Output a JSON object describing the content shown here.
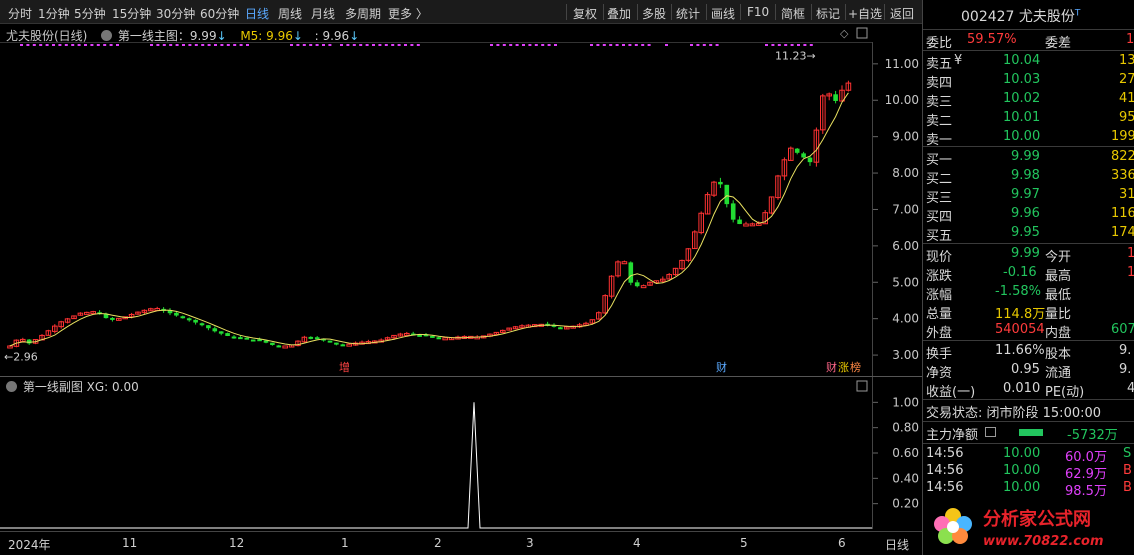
{
  "toolbar": {
    "periods": [
      "分时",
      "1分钟",
      "5分钟",
      "15分钟",
      "30分钟",
      "60分钟",
      "日线",
      "周线",
      "月线",
      "多周期",
      "更多 〉"
    ],
    "buttons": [
      "复权",
      "叠加",
      "多股",
      "统计",
      "画线",
      "F10",
      "简框",
      "标记",
      "+自选",
      "返回"
    ]
  },
  "chart": {
    "stock_label": "尤夫股份(日线)",
    "indicator_name": "第一线主图：9.99",
    "ma_label": "M5: 9.96",
    "ma2_label": ": 9.96",
    "low_marker": "←2.96",
    "high_marker": "11.23→",
    "price_ticks": [
      "11.00",
      "10.00",
      "9.00",
      "8.00",
      "7.00",
      "6.00",
      "5.00",
      "4.00",
      "3.00"
    ],
    "events": [
      "增",
      "财",
      "财",
      "涨",
      "榜"
    ],
    "sub_indicator": "第一线副图  XG: 0.00",
    "sub_ticks": [
      "1.00",
      "0.80",
      "0.60",
      "0.40",
      "0.20"
    ],
    "time_labels": [
      "2024年",
      "11",
      "12",
      "1",
      "2",
      "3",
      "4",
      "5",
      "6"
    ],
    "period_tag": "日线"
  },
  "chart_data": {
    "type": "candlestick",
    "ylim": [
      2.7,
      11.6
    ],
    "low": 2.96,
    "high": 11.23,
    "last_close": 9.99,
    "ma5": 9.96,
    "sub_indicator_ylim": [
      0,
      1.05
    ],
    "sub_indicator_spike": 1.0
  },
  "quote": {
    "code_name": "002427 尤夫股份",
    "wei_bi_label": "委比",
    "wei_bi": "59.57%",
    "wei_cha_label": "委差",
    "wei_cha": "1",
    "asks": [
      {
        "label": "卖五",
        "flag": "¥",
        "price": "10.04",
        "vol": "13"
      },
      {
        "label": "卖四",
        "flag": "",
        "price": "10.03",
        "vol": "27"
      },
      {
        "label": "卖三",
        "flag": "",
        "price": "10.02",
        "vol": "41"
      },
      {
        "label": "卖二",
        "flag": "",
        "price": "10.01",
        "vol": "95"
      },
      {
        "label": "卖一",
        "flag": "",
        "price": "10.00",
        "vol": "199"
      }
    ],
    "bids": [
      {
        "label": "买一",
        "price": "9.99",
        "vol": "822"
      },
      {
        "label": "买二",
        "price": "9.98",
        "vol": "336"
      },
      {
        "label": "买三",
        "price": "9.97",
        "vol": "31"
      },
      {
        "label": "买四",
        "price": "9.96",
        "vol": "116"
      },
      {
        "label": "买五",
        "price": "9.95",
        "vol": "174"
      }
    ],
    "stats": [
      {
        "l1": "现价",
        "v1": "9.99",
        "c1": "green",
        "l2": "今开",
        "v2": "1",
        "c2": "red"
      },
      {
        "l1": "涨跌",
        "v1": "-0.16",
        "c1": "green",
        "l2": "最高",
        "v2": "1",
        "c2": "red"
      },
      {
        "l1": "涨幅",
        "v1": "-1.58%",
        "c1": "green",
        "l2": "最低",
        "v2": "",
        "c2": "white"
      },
      {
        "l1": "总量",
        "v1": "114.8万",
        "c1": "yellow",
        "l2": "量比",
        "v2": "",
        "c2": "white"
      },
      {
        "l1": "外盘",
        "v1": "540054",
        "c1": "red",
        "l2": "内盘",
        "v2": "607",
        "c2": "green"
      }
    ],
    "stats2": [
      {
        "l1": "换手",
        "v1": "11.66%",
        "l2": "股本",
        "v2": "9."
      },
      {
        "l1": "净资",
        "v1": "0.95",
        "l2": "流通",
        "v2": "9."
      },
      {
        "l1": "收益(一)",
        "v1": "0.010",
        "l2": "PE(动)",
        "v2": "4"
      }
    ],
    "trade_status": "交易状态: 闭市阶段 15:00:00",
    "net_flow_label": "主力净额",
    "net_flow": "-5732万",
    "ticks": [
      {
        "time": "14:56",
        "price": "10.00",
        "vol": "60.0万",
        "side": "S"
      },
      {
        "time": "14:56",
        "price": "10.00",
        "vol": "62.9万",
        "side": "B"
      },
      {
        "time": "14:56",
        "price": "10.00",
        "vol": "98.5万",
        "side": "B"
      }
    ],
    "logo_text": "分析家公式网",
    "logo_url": "www.70822.com"
  }
}
